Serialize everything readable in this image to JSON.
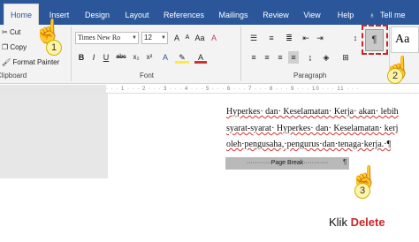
{
  "tabs": [
    "Home",
    "Insert",
    "Design",
    "Layout",
    "References",
    "Mailings",
    "Review",
    "View",
    "Help",
    "Tell me"
  ],
  "clipboard": {
    "cut": "Cut",
    "copy": "Copy",
    "format_painter": "Format Painter",
    "group": "Clipboard"
  },
  "font": {
    "name": "Times New Ro",
    "size": "12",
    "group": "Font",
    "grow": "A",
    "shrink": "A",
    "clear": "A",
    "bold": "B",
    "italic": "I",
    "underline": "U",
    "strike": "abc",
    "subscript": "x₂",
    "superscript": "x²",
    "color": "A"
  },
  "paragraph": {
    "group": "Paragraph",
    "show_marks": "¶"
  },
  "styles": {
    "preview": "Aa"
  },
  "ruler_text": "· · · 1 · · · 2 · · · 3 · · · 4 · · · 5 · · · 6 · · · 7 · · · 8 · · · 9 · · · 10 · · · 11 · · ·",
  "doc": {
    "line1": "Hyperkes· dan· Keselamatan· Kerja· akan· lebih",
    "line2": "syarat-syarat· Hyperkes· dan· Keselamatan· kerj",
    "line3": "oleh·pengusaha,·pengurus·dan·tenaga·kerja.·¶",
    "page_break": "Page Break"
  },
  "steps": [
    "1",
    "2",
    "3"
  ],
  "caption": {
    "prefix": "Klik ",
    "action": "Delete"
  },
  "colors": {
    "ribbon_tab": "#2b579a",
    "highlight": "#c62828"
  }
}
